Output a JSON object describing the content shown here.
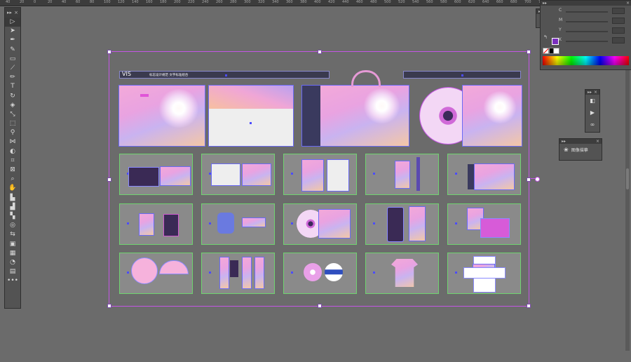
{
  "ruler": {
    "ticks": [
      "40",
      "20",
      "0",
      "20",
      "40",
      "60",
      "80",
      "100",
      "120",
      "140",
      "160",
      "180",
      "200",
      "220",
      "240",
      "260",
      "280",
      "300",
      "320",
      "340",
      "360",
      "380",
      "400",
      "420",
      "440",
      "460",
      "480",
      "500",
      "520",
      "540",
      "560",
      "580",
      "600",
      "620",
      "640",
      "660",
      "680",
      "700",
      "720",
      "740",
      "760",
      "780",
      "800",
      "820",
      "840",
      "860"
    ]
  },
  "toolbar": {
    "collapse": "▸▸",
    "close": "×",
    "tools": [
      {
        "name": "selection-tool-icon",
        "glyph": "▷"
      },
      {
        "name": "direct-selection-tool-icon",
        "glyph": "➤"
      },
      {
        "name": "pen-tool-icon",
        "glyph": "✒"
      },
      {
        "name": "curvature-tool-icon",
        "glyph": "✎"
      },
      {
        "name": "rectangle-tool-icon",
        "glyph": "▭"
      },
      {
        "name": "paintbrush-tool-icon",
        "glyph": "⟋"
      },
      {
        "name": "pencil-tool-icon",
        "glyph": "✏"
      },
      {
        "name": "type-tool-icon",
        "glyph": "T"
      },
      {
        "name": "rotate-tool-icon",
        "glyph": "↻"
      },
      {
        "name": "eraser-tool-icon",
        "glyph": "◈"
      },
      {
        "name": "scale-tool-icon",
        "glyph": "⤡"
      },
      {
        "name": "free-transform-tool-icon",
        "glyph": "⬚"
      },
      {
        "name": "eyedropper-tool-icon",
        "glyph": "⚲"
      },
      {
        "name": "blend-tool-icon",
        "glyph": "⋈"
      },
      {
        "name": "shape-builder-tool-icon",
        "glyph": "◐"
      },
      {
        "name": "artboard-tool-icon",
        "glyph": "⌗"
      },
      {
        "name": "slice-tool-icon",
        "glyph": "⊠"
      },
      {
        "name": "zoom-tool-icon",
        "glyph": "⌕"
      },
      {
        "name": "hand-tool-icon",
        "glyph": "✋"
      },
      {
        "name": "column-graph-tool-icon",
        "glyph": "▙"
      },
      {
        "name": "mesh-tool-icon",
        "glyph": "▟"
      },
      {
        "name": "gradient-tool-icon",
        "glyph": "▚"
      },
      {
        "name": "symbol-sprayer-tool-icon",
        "glyph": "◎"
      },
      {
        "name": "swap-fill-stroke-icon",
        "glyph": "⇆"
      },
      {
        "name": "fill-stroke-icon",
        "glyph": "▣"
      },
      {
        "name": "color-mode-icon",
        "glyph": "▦"
      },
      {
        "name": "draw-mode-icon",
        "glyph": "◔"
      },
      {
        "name": "screen-mode-icon",
        "glyph": "▤"
      },
      {
        "name": "more-tools-icon",
        "glyph": "•••"
      }
    ]
  },
  "color_panel": {
    "collapse": "▸▸",
    "close": "×",
    "channels": [
      "C",
      "M",
      "Y",
      "K"
    ],
    "accent": "#7b2fbf"
  },
  "mini_panel": {
    "collapse": "▸▸",
    "close": "×"
  },
  "layers_panel": {
    "collapse": "▸▸",
    "close": "×"
  },
  "trace_panel": {
    "collapse": "▸▸",
    "close": "×",
    "label": "图像描摹"
  },
  "artboard": {
    "header_left_title": "VIS",
    "header_left_sub": "标志设计规范  文字标准组合",
    "accent": "#c455e6",
    "selection": "#6a6af5",
    "frame": "#6fd36f"
  }
}
